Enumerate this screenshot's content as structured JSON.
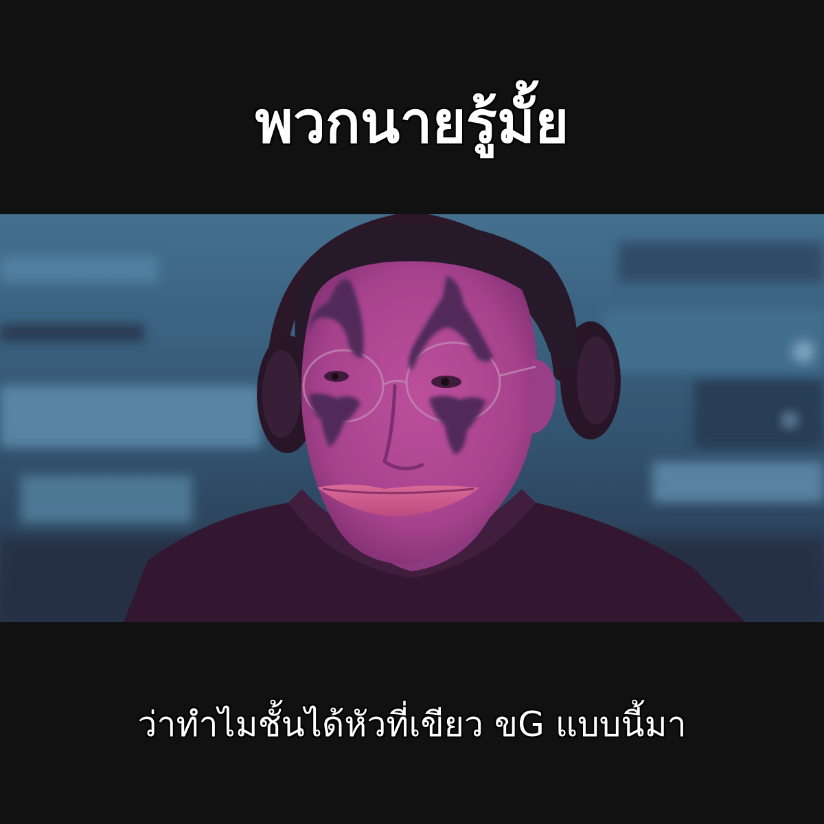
{
  "meme": {
    "top_caption": "พวกนายรู้มั้ย",
    "bottom_caption": "ว่าทำไมชั้นได้หัวที่เขียว ขG แบบนี้มา"
  },
  "photo": {
    "subject": "person-with-clown-makeup-and-headphones",
    "colors": {
      "background_bar": "#111111",
      "backdrop": "#2f5f78",
      "skin_tint": "#b04a9c",
      "makeup": "#4a2a55",
      "lips": "#d8608e",
      "headphones": "#1e1420",
      "shirt": "#2a1428"
    }
  }
}
